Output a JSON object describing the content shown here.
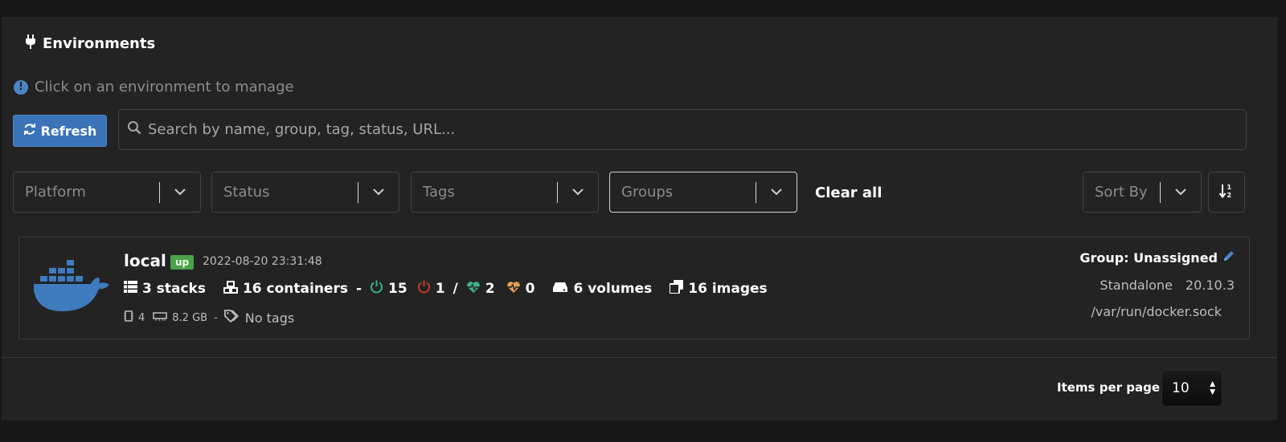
{
  "header": {
    "title": "Environments"
  },
  "hint": {
    "text": "Click on an environment to manage"
  },
  "toolbar": {
    "refresh_label": "Refresh",
    "search_placeholder": "Search by name, group, tag, status, URL..."
  },
  "filters": {
    "platform": "Platform",
    "status": "Status",
    "tags": "Tags",
    "groups": "Groups",
    "clear_all": "Clear all",
    "sort_by": "Sort By"
  },
  "environment": {
    "name": "local",
    "status": "up",
    "timestamp": "2022-08-20 23:31:48",
    "stacks": "3 stacks",
    "containers": "16 containers",
    "running": "15",
    "stopped": "1",
    "slash": "/",
    "healthy": "2",
    "unhealthy": "0",
    "volumes": "6 volumes",
    "images": "16 images",
    "cpu": "4",
    "memory": "8.2 GB",
    "tags": "No tags",
    "group": "Group: Unassigned",
    "type": "Standalone",
    "version": "20.10.3",
    "url": "/var/run/docker.sock"
  },
  "pagination": {
    "label": "Items per page",
    "value": "10"
  },
  "colors": {
    "accent": "#3a73b8",
    "up": "#4ca14b",
    "running": "#3cb48b",
    "stopped": "#c0392b",
    "healthy": "#3cb48b",
    "unhealthy": "#e2a050",
    "docker": "#3e7bbf"
  }
}
